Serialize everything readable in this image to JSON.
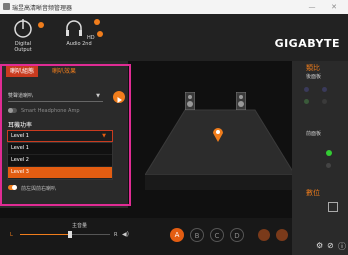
{
  "window": {
    "title": "瑞昱高清晰音频管理器",
    "minimize": "—",
    "close": "✕"
  },
  "header": {
    "brand": "GIGABYTE",
    "devices": [
      {
        "label": "Digital Output"
      },
      {
        "label": "HD Audio 2nd"
      }
    ]
  },
  "tabs": [
    {
      "label": "喇叭組態"
    },
    {
      "label": "喇叭效果"
    }
  ],
  "speaker_config": {
    "selected": "雙聲道喇叭"
  },
  "toggles": {
    "smart_headphone": {
      "label": "Smart Headphone Amp",
      "on": false
    },
    "front_left_right": {
      "label": "前左與前右喇叭",
      "on": true
    }
  },
  "power": {
    "heading": "耳機功率",
    "selected": "Level 1",
    "options": [
      "Level 1",
      "Level 2",
      "Level 3"
    ],
    "highlighted_option": "Level 3"
  },
  "volume": {
    "label": "主音量",
    "l": "L",
    "r": "R",
    "level": 0.55
  },
  "profiles": [
    "A",
    "B",
    "C",
    "D"
  ],
  "right_panel": {
    "analog_title": "類比",
    "analog_sub": "後面板",
    "front_sub": "前面板",
    "digital_title": "數位"
  },
  "colors": {
    "accent": "#f07d1c",
    "active_tab": "#c93b1f",
    "highlight": "#e02c94",
    "dropdown_select": "#e35d12"
  }
}
